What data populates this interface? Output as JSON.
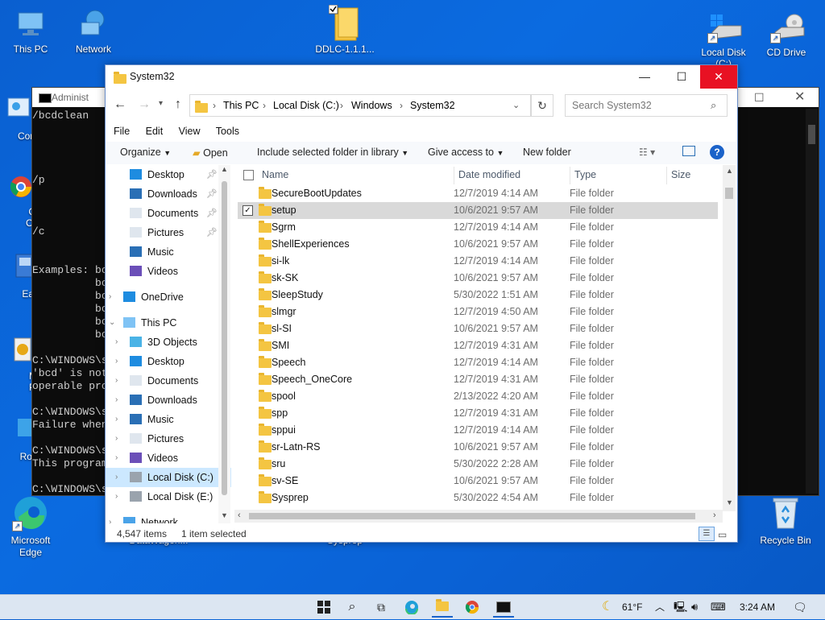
{
  "desktop": {
    "icons": {
      "this_pc": "This PC",
      "network": "Network",
      "ddlc": "DDLC-1.1.1...",
      "local_disk": "Local Disk (C:)",
      "cd_drive": "CD Drive",
      "control": "Contro",
      "google_chrome_1": "Goo",
      "google_chrome_2": "Chro",
      "easybcd": "EasyB",
      "mini_1": "Mini",
      "mini_2": "Part",
      "roblox": "Roblox",
      "edge_1": "Microsoft",
      "edge_2": "Edge",
      "datawagon": "DataWagon...",
      "sysprep": "Sysprep",
      "recycle_bin": "Recycle Bin"
    }
  },
  "cmd": {
    "title": "Administ",
    "lines": [
      "/bcdclean",
      "/p",
      "/c",
      "Examples: bc",
      "          bc",
      "          bc",
      "          bc",
      "          bc",
      "          bc",
      "C:\\WINDOWS\\s",
      "'bcd' is not",
      "operable pro",
      "C:\\WINDOWS\\s",
      "Failure when",
      "C:\\WINDOWS\\s",
      "This program",
      "C:\\WINDOWS\\s"
    ]
  },
  "explorer": {
    "title": "System32",
    "breadcrumb": [
      "This PC",
      "Local Disk (C:)",
      "Windows",
      "System32"
    ],
    "search_placeholder": "Search System32",
    "menu": [
      "File",
      "Edit",
      "View",
      "Tools"
    ],
    "toolbar": {
      "organize": "Organize",
      "open": "Open",
      "include": "Include selected folder in library",
      "give_access": "Give access to",
      "new_folder": "New folder"
    },
    "nav": {
      "quick": [
        {
          "label": "Desktop"
        },
        {
          "label": "Downloads"
        },
        {
          "label": "Documents"
        },
        {
          "label": "Pictures"
        },
        {
          "label": "Music"
        },
        {
          "label": "Videos"
        }
      ],
      "onedrive": "OneDrive",
      "this_pc": "This PC",
      "pc_items": [
        {
          "label": "3D Objects"
        },
        {
          "label": "Desktop"
        },
        {
          "label": "Documents"
        },
        {
          "label": "Downloads"
        },
        {
          "label": "Music"
        },
        {
          "label": "Pictures"
        },
        {
          "label": "Videos"
        },
        {
          "label": "Local Disk (C:)"
        },
        {
          "label": "Local Disk (E:)"
        }
      ],
      "network": "Network"
    },
    "columns": {
      "name": "Name",
      "date": "Date modified",
      "type": "Type",
      "size": "Size"
    },
    "rows": [
      {
        "name": "SecureBootUpdates",
        "date": "12/7/2019 4:14 AM",
        "type": "File folder"
      },
      {
        "name": "setup",
        "date": "10/6/2021 9:57 AM",
        "type": "File folder",
        "selected": true
      },
      {
        "name": "Sgrm",
        "date": "12/7/2019 4:14 AM",
        "type": "File folder"
      },
      {
        "name": "ShellExperiences",
        "date": "10/6/2021 9:57 AM",
        "type": "File folder"
      },
      {
        "name": "si-lk",
        "date": "12/7/2019 4:14 AM",
        "type": "File folder"
      },
      {
        "name": "sk-SK",
        "date": "10/6/2021 9:57 AM",
        "type": "File folder"
      },
      {
        "name": "SleepStudy",
        "date": "5/30/2022 1:51 AM",
        "type": "File folder"
      },
      {
        "name": "slmgr",
        "date": "12/7/2019 4:50 AM",
        "type": "File folder"
      },
      {
        "name": "sl-SI",
        "date": "10/6/2021 9:57 AM",
        "type": "File folder"
      },
      {
        "name": "SMI",
        "date": "12/7/2019 4:31 AM",
        "type": "File folder"
      },
      {
        "name": "Speech",
        "date": "12/7/2019 4:14 AM",
        "type": "File folder"
      },
      {
        "name": "Speech_OneCore",
        "date": "12/7/2019 4:31 AM",
        "type": "File folder"
      },
      {
        "name": "spool",
        "date": "2/13/2022 4:20 AM",
        "type": "File folder"
      },
      {
        "name": "spp",
        "date": "12/7/2019 4:31 AM",
        "type": "File folder"
      },
      {
        "name": "sppui",
        "date": "12/7/2019 4:14 AM",
        "type": "File folder"
      },
      {
        "name": "sr-Latn-RS",
        "date": "10/6/2021 9:57 AM",
        "type": "File folder"
      },
      {
        "name": "sru",
        "date": "5/30/2022 2:28 AM",
        "type": "File folder"
      },
      {
        "name": "sv-SE",
        "date": "10/6/2021 9:57 AM",
        "type": "File folder"
      },
      {
        "name": "Sysprep",
        "date": "5/30/2022 4:54 AM",
        "type": "File folder"
      }
    ],
    "status": {
      "items": "4,547 items",
      "selected": "1 item selected"
    }
  },
  "taskbar": {
    "temperature": "61°F",
    "time": "3:24 AM"
  }
}
